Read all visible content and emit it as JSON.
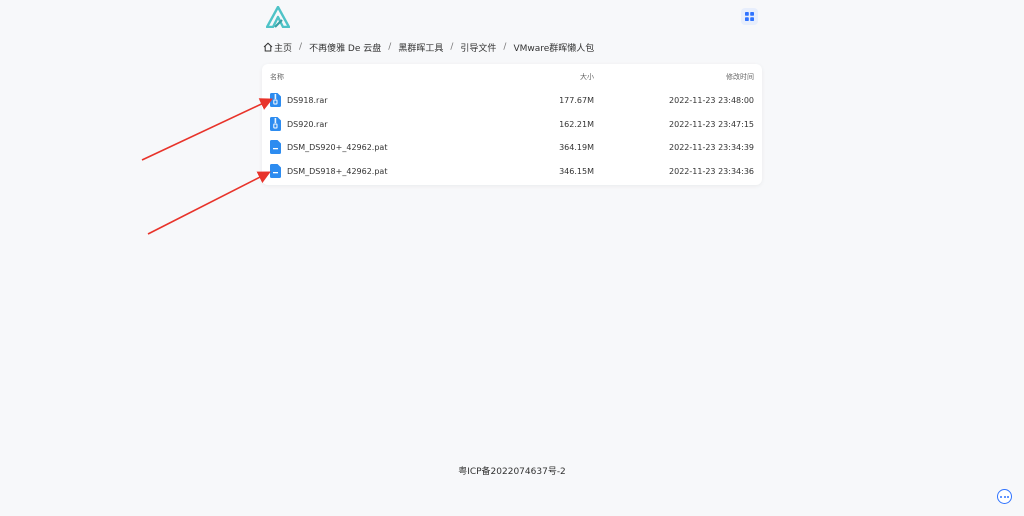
{
  "breadcrumb": {
    "home": "主页",
    "separator": "/",
    "items": [
      "不再傻雅 De 云盘",
      "黑群晖工具",
      "引导文件",
      "VMware群晖懒人包"
    ]
  },
  "file_list": {
    "headers": {
      "name": "名称",
      "size": "大小",
      "modified": "修改时间"
    },
    "files": [
      {
        "name": "DS918.rar",
        "size": "177.67M",
        "modified": "2022-11-23 23:48:00",
        "icon": "archive-file-icon"
      },
      {
        "name": "DS920.rar",
        "size": "162.21M",
        "modified": "2022-11-23 23:47:15",
        "icon": "archive-file-icon"
      },
      {
        "name": "DSM_DS920+_42962.pat",
        "size": "364.19M",
        "modified": "2022-11-23 23:34:39",
        "icon": "file-icon"
      },
      {
        "name": "DSM_DS918+_42962.pat",
        "size": "346.15M",
        "modified": "2022-11-23 23:34:36",
        "icon": "file-icon"
      }
    ]
  },
  "footer": {
    "icp": "粤ICP备2022074637号-2"
  },
  "colors": {
    "accent": "#2f73ff",
    "file_icon": "#2d8cf0",
    "logo_teal": "#4fc3c7",
    "annotation_arrow": "#e8332a"
  },
  "icons": {
    "logo": "app-logo",
    "grid": "grid-icon",
    "home": "home-icon",
    "chat": "chat-bubble-icon"
  }
}
